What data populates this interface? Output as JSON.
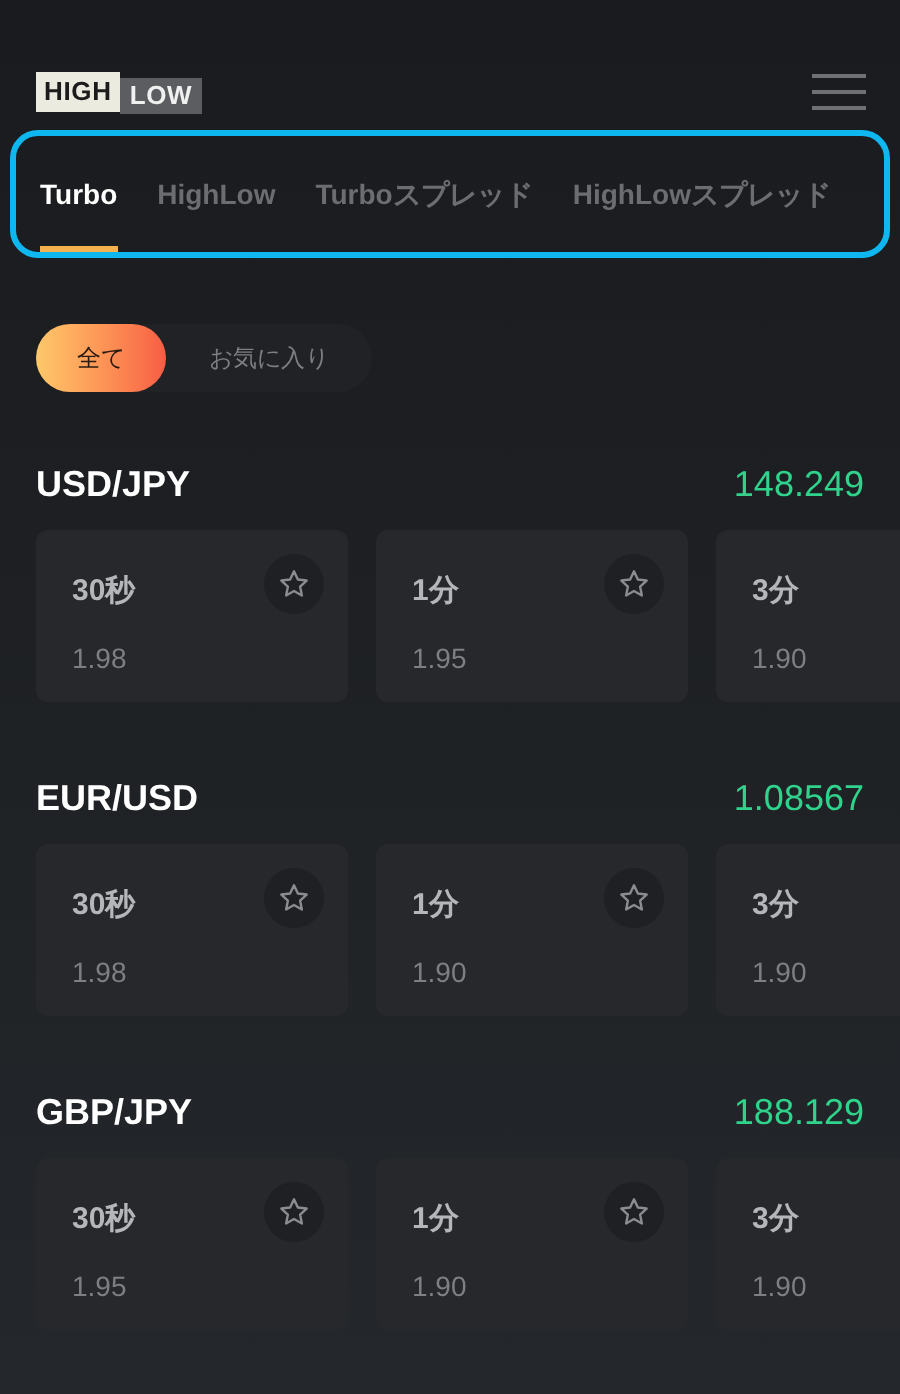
{
  "logo": {
    "left": "HIGH",
    "right": "LOW"
  },
  "tabs": [
    {
      "label": "Turbo",
      "selected": true
    },
    {
      "label": "HighLow",
      "selected": false
    },
    {
      "label": "Turboスプレッド",
      "selected": false
    },
    {
      "label": "HighLowスプレッド",
      "selected": false
    }
  ],
  "filters": [
    {
      "label": "全て",
      "selected": true
    },
    {
      "label": "お気に入り",
      "selected": false
    }
  ],
  "markets": [
    {
      "pair": "USD/JPY",
      "price": "148.249",
      "options": [
        {
          "duration": "30秒",
          "payout": "1.98",
          "favorite": false
        },
        {
          "duration": "1分",
          "payout": "1.95",
          "favorite": false
        },
        {
          "duration": "3分",
          "payout": "1.90"
        }
      ]
    },
    {
      "pair": "EUR/USD",
      "price": "1.08567",
      "options": [
        {
          "duration": "30秒",
          "payout": "1.98",
          "favorite": false
        },
        {
          "duration": "1分",
          "payout": "1.90",
          "favorite": false
        },
        {
          "duration": "3分",
          "payout": "1.90"
        }
      ]
    },
    {
      "pair": "GBP/JPY",
      "price": "188.129",
      "options": [
        {
          "duration": "30秒",
          "payout": "1.95",
          "favorite": false
        },
        {
          "duration": "1分",
          "payout": "1.90",
          "favorite": false
        },
        {
          "duration": "3分",
          "payout": "1.90"
        }
      ]
    }
  ]
}
